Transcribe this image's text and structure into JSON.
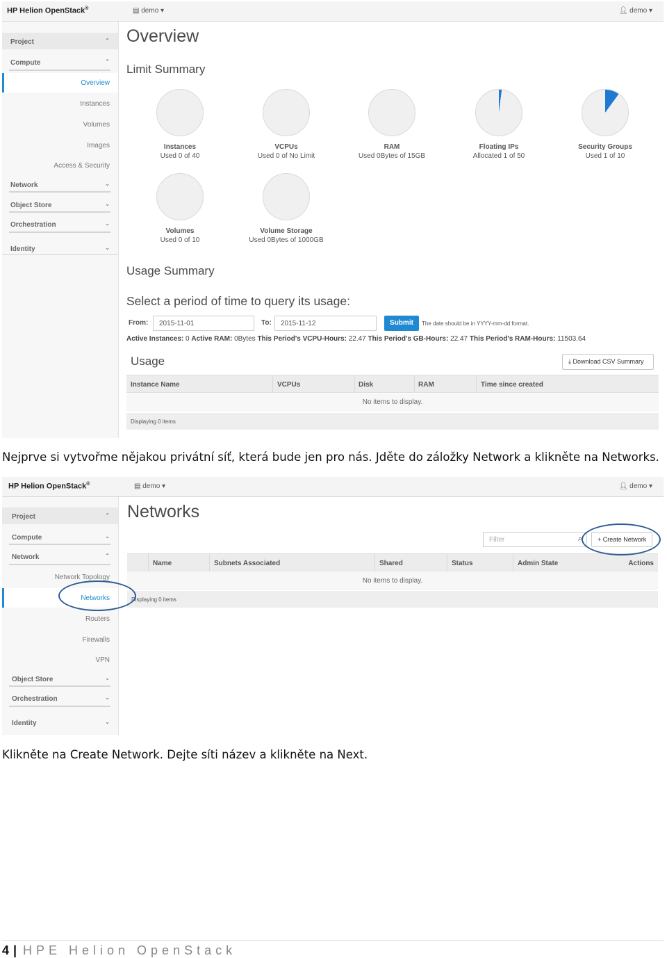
{
  "shot1": {
    "brand": "HP Helion OpenStack",
    "brand_mark": "®",
    "project_menu": "demo",
    "user_menu": "demo",
    "sidebar": {
      "project": "Project",
      "compute": "Compute",
      "items": [
        "Overview",
        "Instances",
        "Volumes",
        "Images",
        "Access & Security"
      ],
      "network": "Network",
      "object_store": "Object Store",
      "orchestration": "Orchestration",
      "identity": "Identity"
    },
    "title": "Overview",
    "limit_summary": "Limit Summary",
    "pies": [
      {
        "name": "Instances",
        "detail": "Used 0 of 40",
        "fraction": 0
      },
      {
        "name": "VCPUs",
        "detail": "Used 0 of No Limit",
        "fraction": 0
      },
      {
        "name": "RAM",
        "detail": "Used 0Bytes of 15GB",
        "fraction": 0
      },
      {
        "name": "Floating IPs",
        "detail": "Allocated 1 of 50",
        "fraction": 0.02
      },
      {
        "name": "Security Groups",
        "detail": "Used 1 of 10",
        "fraction": 0.1
      },
      {
        "name": "Volumes",
        "detail": "Used 0 of 10",
        "fraction": 0
      },
      {
        "name": "Volume Storage",
        "detail": "Used 0Bytes of 1000GB",
        "fraction": 0
      }
    ],
    "usage_summary": "Usage Summary",
    "period_heading": "Select a period of time to query its usage:",
    "from_label": "From:",
    "from_value": "2015-11-01",
    "to_label": "To:",
    "to_value": "2015-11-12",
    "submit": "Submit",
    "date_hint": "The date should be in YYYY-mm-dd format.",
    "stats": {
      "instances_label": "Active Instances:",
      "instances_value": "0",
      "ram_label": "Active RAM:",
      "ram_value": "0Bytes",
      "vcpu_label": "This Period's VCPU-Hours:",
      "vcpu_value": "22.47",
      "gb_label": "This Period's GB-Hours:",
      "gb_value": "22.47",
      "ramh_label": "This Period's RAM-Hours:",
      "ramh_value": "11503.64"
    },
    "usage_title": "Usage",
    "download_csv": "Download CSV Summary",
    "columns": [
      "Instance Name",
      "VCPUs",
      "Disk",
      "RAM",
      "Time since created"
    ],
    "empty": "No items to display.",
    "footer": "Displaying 0 items"
  },
  "para1": "Nejprve si vytvořme nějakou privátní síť, která bude jen pro nás. Jděte do záložky Network a klikněte na Networks.",
  "shot2": {
    "brand": "HP Helion OpenStack",
    "brand_mark": "®",
    "project_menu": "demo",
    "user_menu": "demo",
    "sidebar": {
      "project": "Project",
      "compute": "Compute",
      "network": "Network",
      "items": [
        "Network Topology",
        "Networks",
        "Routers",
        "Firewalls",
        "VPN"
      ],
      "object_store": "Object Store",
      "orchestration": "Orchestration",
      "identity": "Identity"
    },
    "title": "Networks",
    "filter_placeholder": "Filter",
    "create_network": "Create Network",
    "columns": [
      "Name",
      "Subnets Associated",
      "Shared",
      "Status",
      "Admin State",
      "Actions"
    ],
    "empty": "No items to display.",
    "footer": "Displaying 0 items"
  },
  "para2": "Klikněte na Create Network. Dejte síti název a klikněte na Next.",
  "page_footer": {
    "number": "4",
    "separator": "|",
    "title": "HPE Helion OpenStack"
  },
  "colors": {
    "accent": "#1f8ad2",
    "annotation": "#2c5d95"
  }
}
